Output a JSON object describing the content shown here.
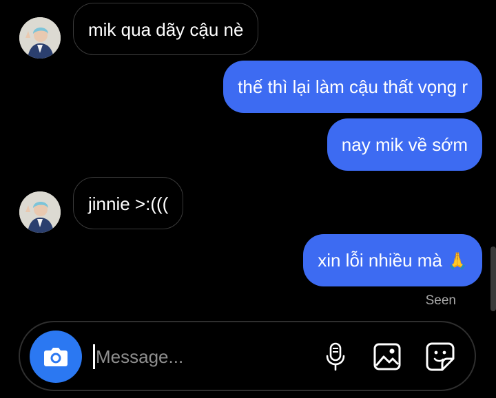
{
  "messages": [
    {
      "direction": "incoming",
      "text": "mik qua dãy cậu nè"
    },
    {
      "direction": "outgoing",
      "text": "thế thì lại làm cậu thất vọng r"
    },
    {
      "direction": "outgoing",
      "text": "nay mik về sớm"
    },
    {
      "direction": "incoming",
      "text": "jinnie >:((("
    },
    {
      "direction": "outgoing",
      "text": "xin lỗi nhiều mà",
      "emoji": "🙏"
    }
  ],
  "seen_label": "Seen",
  "composer": {
    "placeholder": "Message...",
    "icons": [
      "camera-icon",
      "microphone-icon",
      "gallery-icon",
      "sticker-icon"
    ]
  },
  "colors": {
    "background": "#000000",
    "outgoing_bubble": "#3d6bf2",
    "incoming_border": "#3a3a3a",
    "camera_button": "#2b78f2"
  }
}
